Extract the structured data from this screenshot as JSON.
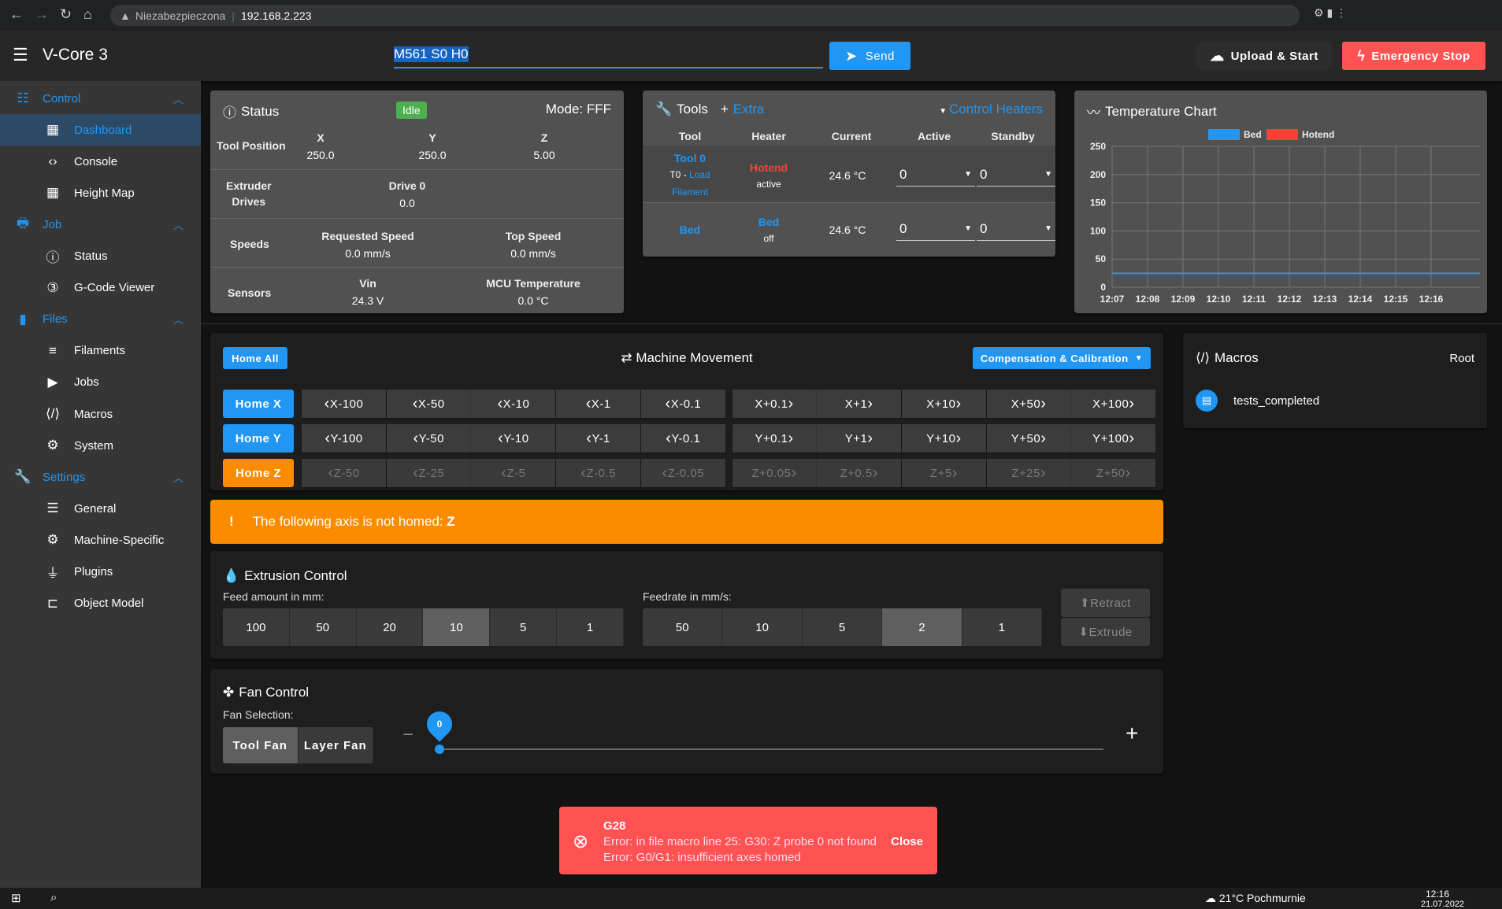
{
  "browser": {
    "security": "Niezabezpieczona",
    "url": "192.168.2.223"
  },
  "appbar": {
    "title": "V-Core 3",
    "command": "M561 S0 H0",
    "send": "Send",
    "upload": "Upload & Start",
    "estop": "Emergency Stop"
  },
  "sidebar": [
    {
      "label": "Control",
      "group": true,
      "icon": "sliders-icon"
    },
    {
      "label": "Dashboard",
      "icon": "dashboard-icon",
      "active": true
    },
    {
      "label": "Console",
      "icon": "code-icon"
    },
    {
      "label": "Height Map",
      "icon": "grid-icon"
    },
    {
      "label": "Job",
      "group": true,
      "icon": "printer-icon"
    },
    {
      "label": "Status",
      "icon": "info-icon"
    },
    {
      "label": "G-Code Viewer",
      "icon": "3d-icon"
    },
    {
      "label": "Files",
      "group": true,
      "icon": "sd-card-icon"
    },
    {
      "label": "Filaments",
      "icon": "database-icon"
    },
    {
      "label": "Jobs",
      "icon": "play-icon"
    },
    {
      "label": "Macros",
      "icon": "macro-icon"
    },
    {
      "label": "System",
      "icon": "gear-icon"
    },
    {
      "label": "Settings",
      "group": true,
      "icon": "wrench-icon"
    },
    {
      "label": "General",
      "icon": "tune-icon"
    },
    {
      "label": "Machine-Specific",
      "icon": "gears-icon"
    },
    {
      "label": "Plugins",
      "icon": "plug-icon"
    },
    {
      "label": "Object Model",
      "icon": "tree-icon"
    }
  ],
  "status": {
    "title": "Status",
    "state": "Idle",
    "mode": "Mode: FFF",
    "tool_position": "Tool Position",
    "axes": [
      {
        "name": "X",
        "value": "250.0"
      },
      {
        "name": "Y",
        "value": "250.0"
      },
      {
        "name": "Z",
        "value": "5.00"
      }
    ],
    "extruder_label1": "Extruder",
    "extruder_label2": "Drives",
    "drive_name": "Drive 0",
    "drive_value": "0.0",
    "speeds": "Speeds",
    "req_speed": "Requested Speed",
    "req_value": "0.0 mm/s",
    "top_speed": "Top Speed",
    "top_value": "0.0 mm/s",
    "sensors": "Sensors",
    "vin": "Vin",
    "vin_value": "24.3 V",
    "mcu": "MCU Temperature",
    "mcu_value": "0.0 °C"
  },
  "tools": {
    "title": "Tools",
    "extra": "Extra",
    "control": "Control Heaters",
    "headers": [
      "Tool",
      "Heater",
      "Current",
      "Active",
      "Standby"
    ],
    "rows": [
      {
        "tool": "Tool 0",
        "sub": "T0 - ",
        "load": "Load",
        "filament": "Filament",
        "heater": "Hotend",
        "heater_state": "active",
        "current": "24.6 °C",
        "active": "0",
        "standby": "0"
      },
      {
        "tool": "Bed",
        "heater": "Bed",
        "heater_state": "off",
        "current": "24.6 °C",
        "active": "0",
        "standby": "0"
      }
    ]
  },
  "colors": {
    "accent": "#2196f3",
    "warning": "#fb8c00",
    "error": "#ff5252",
    "idle": "#4caf50",
    "hotend": "#f44336"
  },
  "chart_data": {
    "type": "line",
    "title": "Temperature Chart",
    "categories": [
      "12:07",
      "12:08",
      "12:09",
      "12:10",
      "12:11",
      "12:12",
      "12:13",
      "12:14",
      "12:15",
      "12:16"
    ],
    "yticks": [
      0,
      50,
      100,
      150,
      200,
      250
    ],
    "ylim": [
      0,
      250
    ],
    "grid": true,
    "legend": "top",
    "series": [
      {
        "name": "Bed",
        "color": "#2196f3",
        "values": [
          24.6,
          24.6,
          24.6,
          24.6,
          24.6,
          24.6,
          24.6,
          24.6,
          24.6,
          24.6
        ]
      },
      {
        "name": "Hotend",
        "color": "#f44336",
        "values": [
          24.6,
          24.6,
          24.6,
          24.6,
          24.6,
          24.6,
          24.6,
          24.6,
          24.6,
          24.6
        ]
      }
    ]
  },
  "movement": {
    "title": "Machine Movement",
    "home_all": "Home All",
    "comp": "Compensation & Calibration",
    "rows": [
      {
        "home": "Home X",
        "homed": true,
        "steps": [
          "X-100",
          "X-50",
          "X-10",
          "X-1",
          "X-0.1",
          "X+0.1",
          "X+1",
          "X+10",
          "X+50",
          "X+100"
        ]
      },
      {
        "home": "Home Y",
        "homed": true,
        "steps": [
          "Y-100",
          "Y-50",
          "Y-10",
          "Y-1",
          "Y-0.1",
          "Y+0.1",
          "Y+1",
          "Y+10",
          "Y+50",
          "Y+100"
        ]
      },
      {
        "home": "Home Z",
        "homed": false,
        "steps": [
          "Z-50",
          "Z-25",
          "Z-5",
          "Z-0.5",
          "Z-0.05",
          "Z+0.05",
          "Z+0.5",
          "Z+5",
          "Z+25",
          "Z+50"
        ]
      }
    ]
  },
  "warning": {
    "text": "The following axis is not homed: ",
    "axis": "Z"
  },
  "extrusion": {
    "title": "Extrusion Control",
    "feed_label": "Feed amount in mm:",
    "feeds": [
      "100",
      "50",
      "20",
      "10",
      "5",
      "1"
    ],
    "feed_selected": "10",
    "rate_label": "Feedrate in mm/s:",
    "rates": [
      "50",
      "10",
      "5",
      "2",
      "1"
    ],
    "rate_selected": "2",
    "retract": "Retract",
    "extrude": "Extrude"
  },
  "fan": {
    "title": "Fan Control",
    "selection": "Fan Selection:",
    "fans": [
      "Tool Fan",
      "Layer Fan"
    ],
    "selected": "Tool Fan",
    "value": "0",
    "percent": 0
  },
  "macros": {
    "title": "Macros",
    "root": "Root",
    "items": [
      "tests_completed"
    ]
  },
  "error": {
    "title": "G28",
    "line1": "Error: in file macro line 25: G30: Z probe 0 not found",
    "line2": "Error: G0/G1: insufficient axes homed",
    "close": "Close"
  },
  "taskbar": {
    "weather": "21°C  Pochmurnie",
    "time": "12:16",
    "date": "21.07.2022"
  }
}
